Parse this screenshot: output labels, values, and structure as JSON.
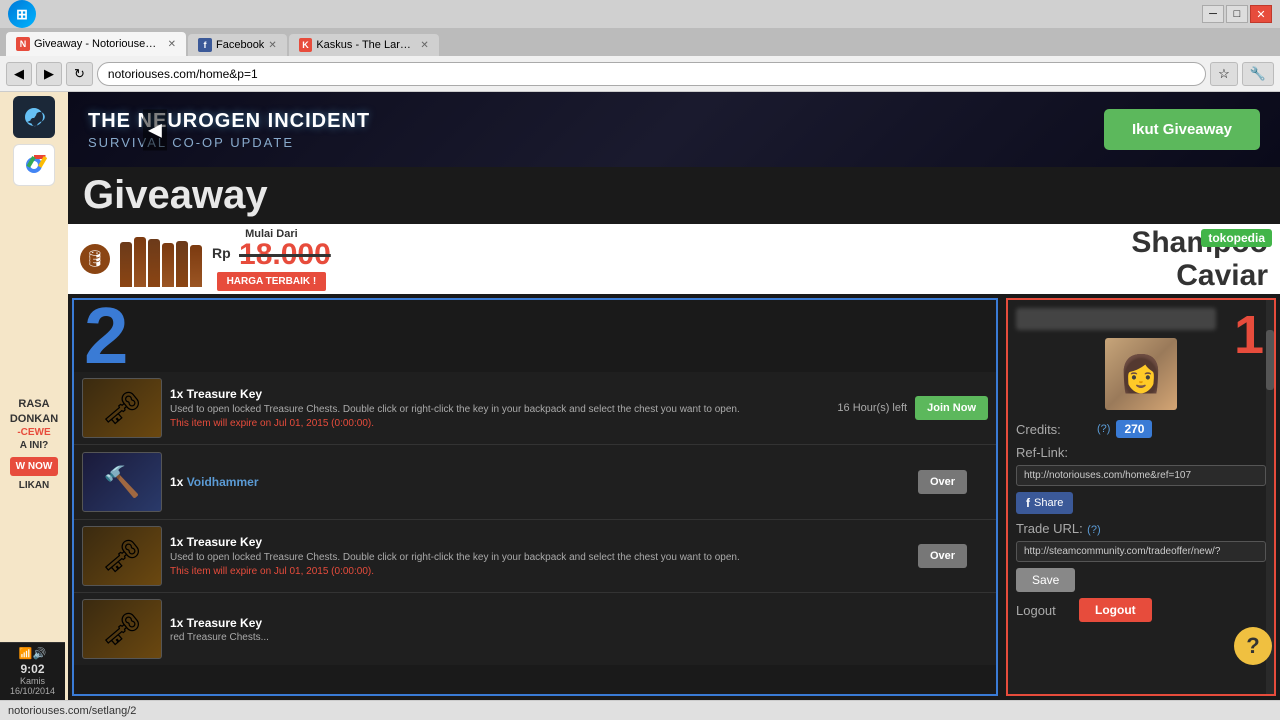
{
  "browser": {
    "tabs": [
      {
        "label": "Giveaway - Notoriouses...",
        "favicon": "N",
        "active": true
      },
      {
        "label": "Facebook",
        "favicon": "f",
        "active": false
      },
      {
        "label": "Kaskus - The Largest Indo...",
        "favicon": "K",
        "active": false
      }
    ],
    "url": "notoriouses.com/home&p=1"
  },
  "hero": {
    "title": "THE NEUROGEN INCIDENT",
    "subtitle": "SURVIVAL CO-OP UPDATE",
    "ikut_btn": "Ikut Giveaway"
  },
  "giveaway_title": "Giveaway",
  "ad": {
    "price": "18.000",
    "currency": "Rp",
    "product": "Shampoo\nCaviar",
    "harga_btn": "HARGA TERBAIK !",
    "brand": "tokopedia"
  },
  "step": "2",
  "items": [
    {
      "name": "1x Treasure Key",
      "link": "",
      "time_left": "16 Hour(s) left",
      "desc": "Used to open locked Treasure Chests. Double click or right-click the key in your backpack and select the chest you want to open.",
      "expire": "This item will expire on Jul 01, 2015 (0:00:00).",
      "action": "join",
      "action_label": "Join Now",
      "type": "key"
    },
    {
      "name": "1x ",
      "link": "Voidhammer",
      "time_left": "",
      "desc": "",
      "expire": "",
      "action": "over",
      "action_label": "Over",
      "type": "hammer"
    },
    {
      "name": "1x Treasure Key",
      "link": "",
      "time_left": "",
      "desc": "Used to open locked Treasure Chests. Double click or right-click the key in your backpack and select the chest you want to open.",
      "expire": "This item will expire on Jul 01, 2015 (0:00:00).",
      "action": "over",
      "action_label": "Over",
      "type": "key"
    },
    {
      "name": "1x Treasure Key",
      "link": "",
      "time_left": "",
      "desc": "red Treasure Chests...",
      "expire": "",
      "action": "none",
      "action_label": "",
      "type": "key"
    }
  ],
  "user": {
    "rank": "1",
    "credits_label": "Credits:",
    "credits_question": "(?)",
    "credits_value": "270",
    "ref_link_label": "Ref-Link:",
    "ref_link_value": "http://notoriouses.com/home&ref=107",
    "share_label": "Share",
    "trade_url_label": "Trade URL:",
    "trade_url_question": "(?)",
    "trade_url_value": "http://steamcommunity.com/tradeoffer/new/?",
    "save_label": "Save",
    "logout_label": "Logout",
    "logout_btn": "Logout"
  },
  "taskbar": {
    "time": "9:02",
    "day": "Kamis",
    "date": "16/10/2014"
  },
  "status_bar": {
    "url": "notoriouses.com/setlang/2"
  }
}
